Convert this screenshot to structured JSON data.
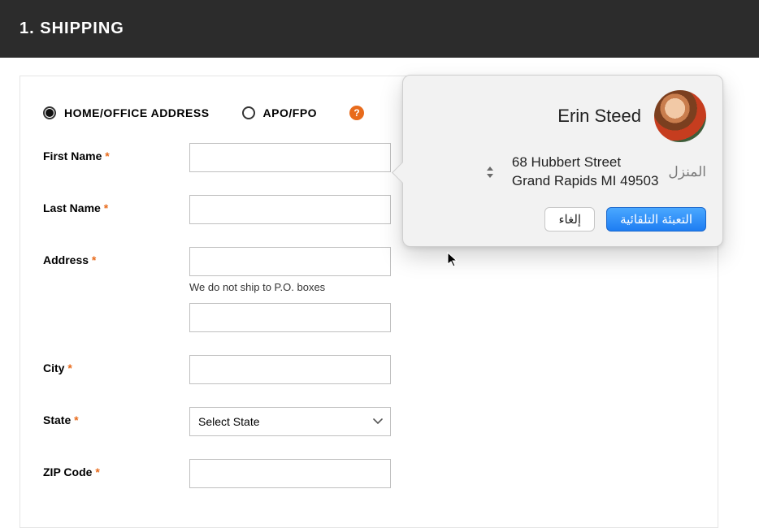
{
  "header": {
    "title": "1. Shipping"
  },
  "radios": {
    "home": {
      "label": "HOME/OFFICE ADDRESS",
      "selected": true
    },
    "apo": {
      "label": "APO/FPO",
      "selected": false
    },
    "help_glyph": "?"
  },
  "fields": {
    "first_name": {
      "label": "First Name",
      "value": ""
    },
    "last_name": {
      "label": "Last Name",
      "value": ""
    },
    "address": {
      "label": "Address",
      "value": "",
      "hint": "We do not ship to P.O. boxes"
    },
    "address2": {
      "value": ""
    },
    "city": {
      "label": "City",
      "value": ""
    },
    "state": {
      "label": "State",
      "placeholder": "Select State"
    },
    "zip": {
      "label": "ZIP Code",
      "value": ""
    }
  },
  "required_marker": "*",
  "autofill": {
    "name": "Erin Steed",
    "type_label_ar": "المنزل",
    "address_line1": "68 Hubbert Street",
    "address_line2": "Grand Rapids MI 49503",
    "buttons": {
      "autofill_ar": "التعبئة التلقائية",
      "cancel_ar": "إلغاء"
    }
  }
}
